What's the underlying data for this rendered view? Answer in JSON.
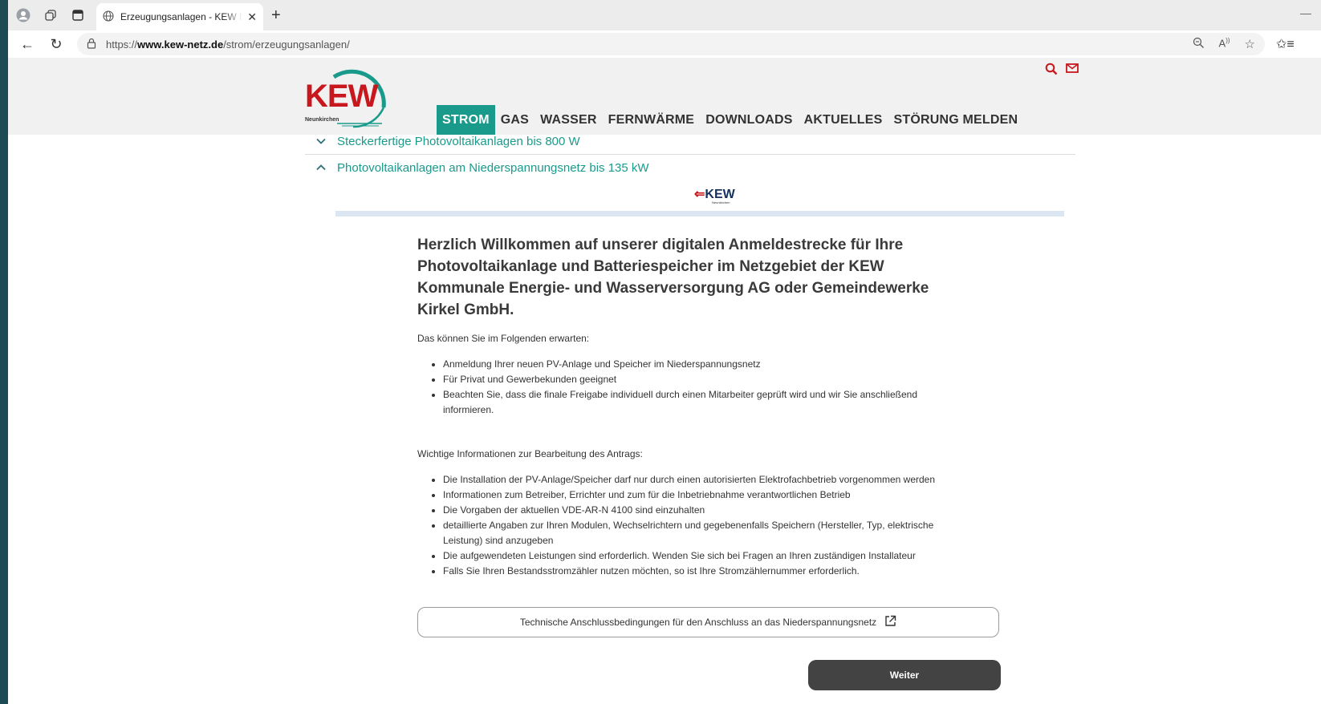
{
  "browser": {
    "tab_title": "Erzeugungsanlagen - KEW Netz N",
    "url_prefix": "https://",
    "url_domain": "www.kew-netz.de",
    "url_path": "/strom/erzeugungsanlagen/"
  },
  "site": {
    "logo_text": "KEW",
    "logo_sub": "Neunkirchen",
    "nav": [
      {
        "label": "STROM",
        "active": true
      },
      {
        "label": "GAS"
      },
      {
        "label": "WASSER"
      },
      {
        "label": "FERNWÄRME"
      },
      {
        "label": "DOWNLOADS"
      },
      {
        "label": "AKTUELLES"
      },
      {
        "label": "STÖRUNG MELDEN"
      }
    ]
  },
  "accordion": [
    {
      "label": "Steckerfertige Photovoltaikanlagen bis 800 W",
      "state": "collapsed"
    },
    {
      "label": "Photovoltaikanlagen am Niederspannungsnetz bis 135 kW",
      "state": "expanded"
    }
  ],
  "form": {
    "logo_text": "KEW",
    "logo_sub": "Neunkirchen",
    "progress": 0,
    "heading": "Herzlich Willkommen auf unserer digitalen Anmeldestrecke für Ihre Photovoltaikanlage und Batteriespeicher im Netzgebiet der KEW Kommunale Energie- und Wasserversorgung AG oder Gemeindewerke Kirkel GmbH.",
    "intro_label": "Das können Sie im Folgenden erwarten:",
    "intro_items": [
      "Anmeldung Ihrer neuen PV-Anlage und Speicher im Niederspannungsnetz",
      "Für Privat und Gewerbekunden geeignet",
      "Beachten Sie, dass die finale Freigabe individuell durch einen Mitarbeiter geprüft wird und wir Sie anschließend informieren."
    ],
    "info_label": "Wichtige Informationen zur Bearbeitung des Antrags:",
    "info_items": [
      "Die Installation der PV-Anlage/Speicher darf nur durch einen autorisierten Elektrofachbetrieb vorgenommen werden",
      "Informationen zum Betreiber, Errichter und zum für die Inbetriebnahme verantwortlichen Betrieb",
      "Die Vorgaben der aktuellen VDE-AR-N 4100 sind einzuhalten",
      "detaillierte Angaben zur Ihren Modulen, Wechselrichtern und gegebenenfalls Speichern (Hersteller, Typ, elektrische Leistung) sind anzugeben",
      "Die aufgewendeten Leistungen sind erforderlich. Wenden Sie sich bei Fragen an Ihren zuständigen Installateur",
      "Falls Sie Ihren Bestandsstromzähler nutzen möchten, so ist Ihre Stromzählernummer erforderlich."
    ],
    "tab_link_label": "Technische Anschlussbedingungen für den Anschluss an das Niederspannungsnetz",
    "weiter_label": "Weiter"
  },
  "colors": {
    "brand_red": "#c8171d",
    "brand_teal": "#1a9a8b",
    "button_dark": "#434343"
  },
  "icons": [
    "profile-icon",
    "collections-icon",
    "sidebar-icon",
    "globe-icon",
    "close-icon",
    "new-tab-icon",
    "back-icon",
    "reload-icon",
    "lock-icon",
    "zoom-icon",
    "read-aloud-icon",
    "favorite-icon",
    "favorites-bar-icon",
    "search-icon",
    "mail-icon",
    "chevron-down-icon",
    "chevron-up-icon",
    "external-link-icon"
  ]
}
